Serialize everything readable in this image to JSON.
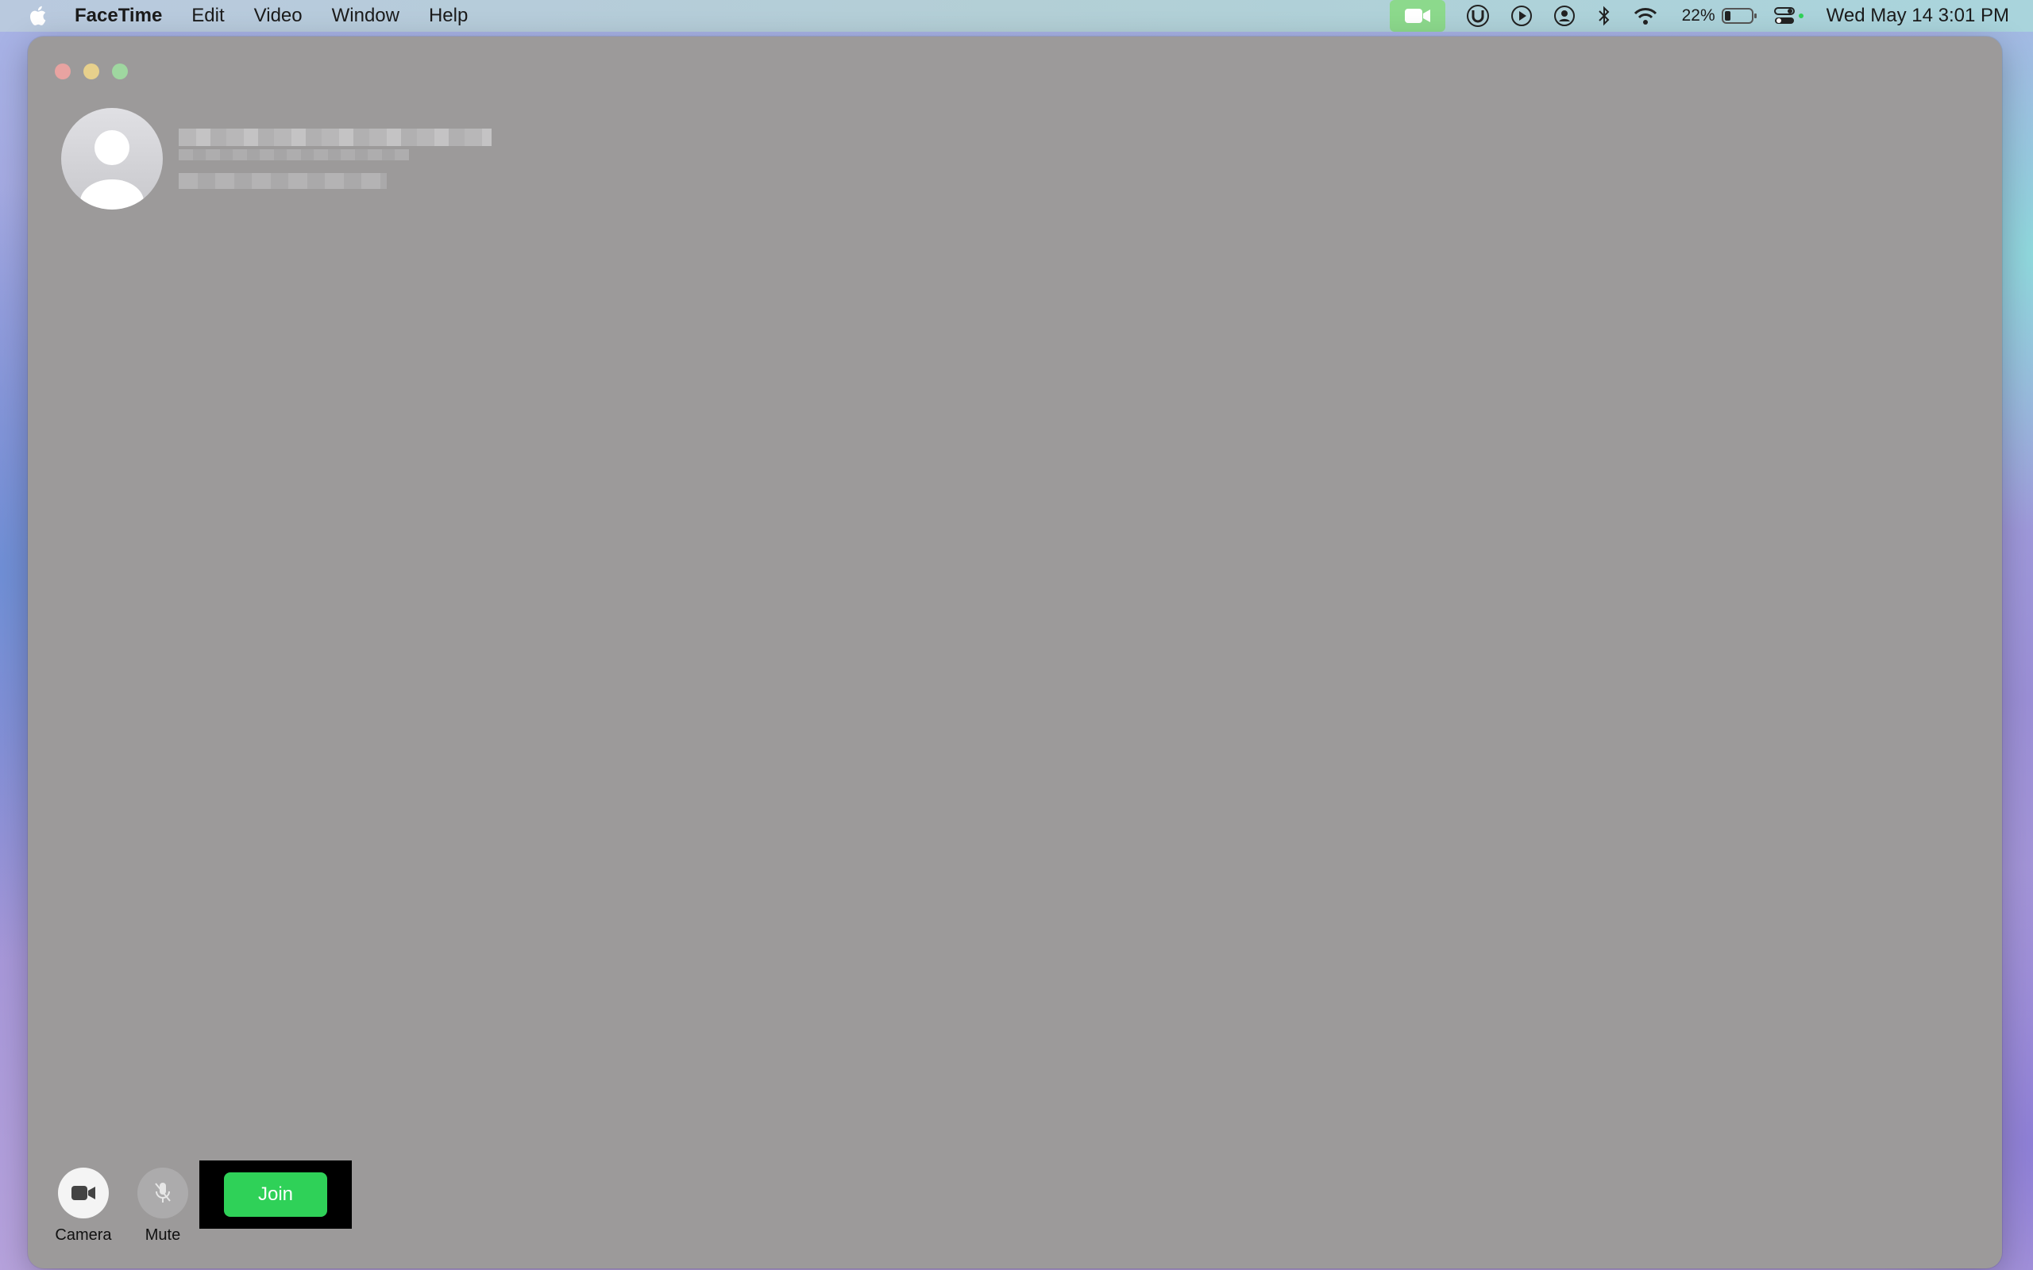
{
  "menubar": {
    "app_name": "FaceTime",
    "items": [
      "Edit",
      "Video",
      "Window",
      "Help"
    ],
    "battery_percent": "22%",
    "battery_level": 0.22,
    "datetime": "Wed May 14  3:01 PM",
    "icons": [
      "apple-icon",
      "facetime-camera-icon",
      "utorrent-icon",
      "play-circle-icon",
      "user-circle-icon",
      "bluetooth-icon",
      "wifi-icon",
      "battery-icon",
      "control-center-icon"
    ]
  },
  "window": {
    "contact": {
      "name": "████████████",
      "subtitle": "████████"
    },
    "controls": {
      "camera_label": "Camera",
      "mute_label": "Mute",
      "join_label": "Join"
    },
    "colors": {
      "join": "#2fd158",
      "window_bg": "#9c9a9a"
    }
  }
}
